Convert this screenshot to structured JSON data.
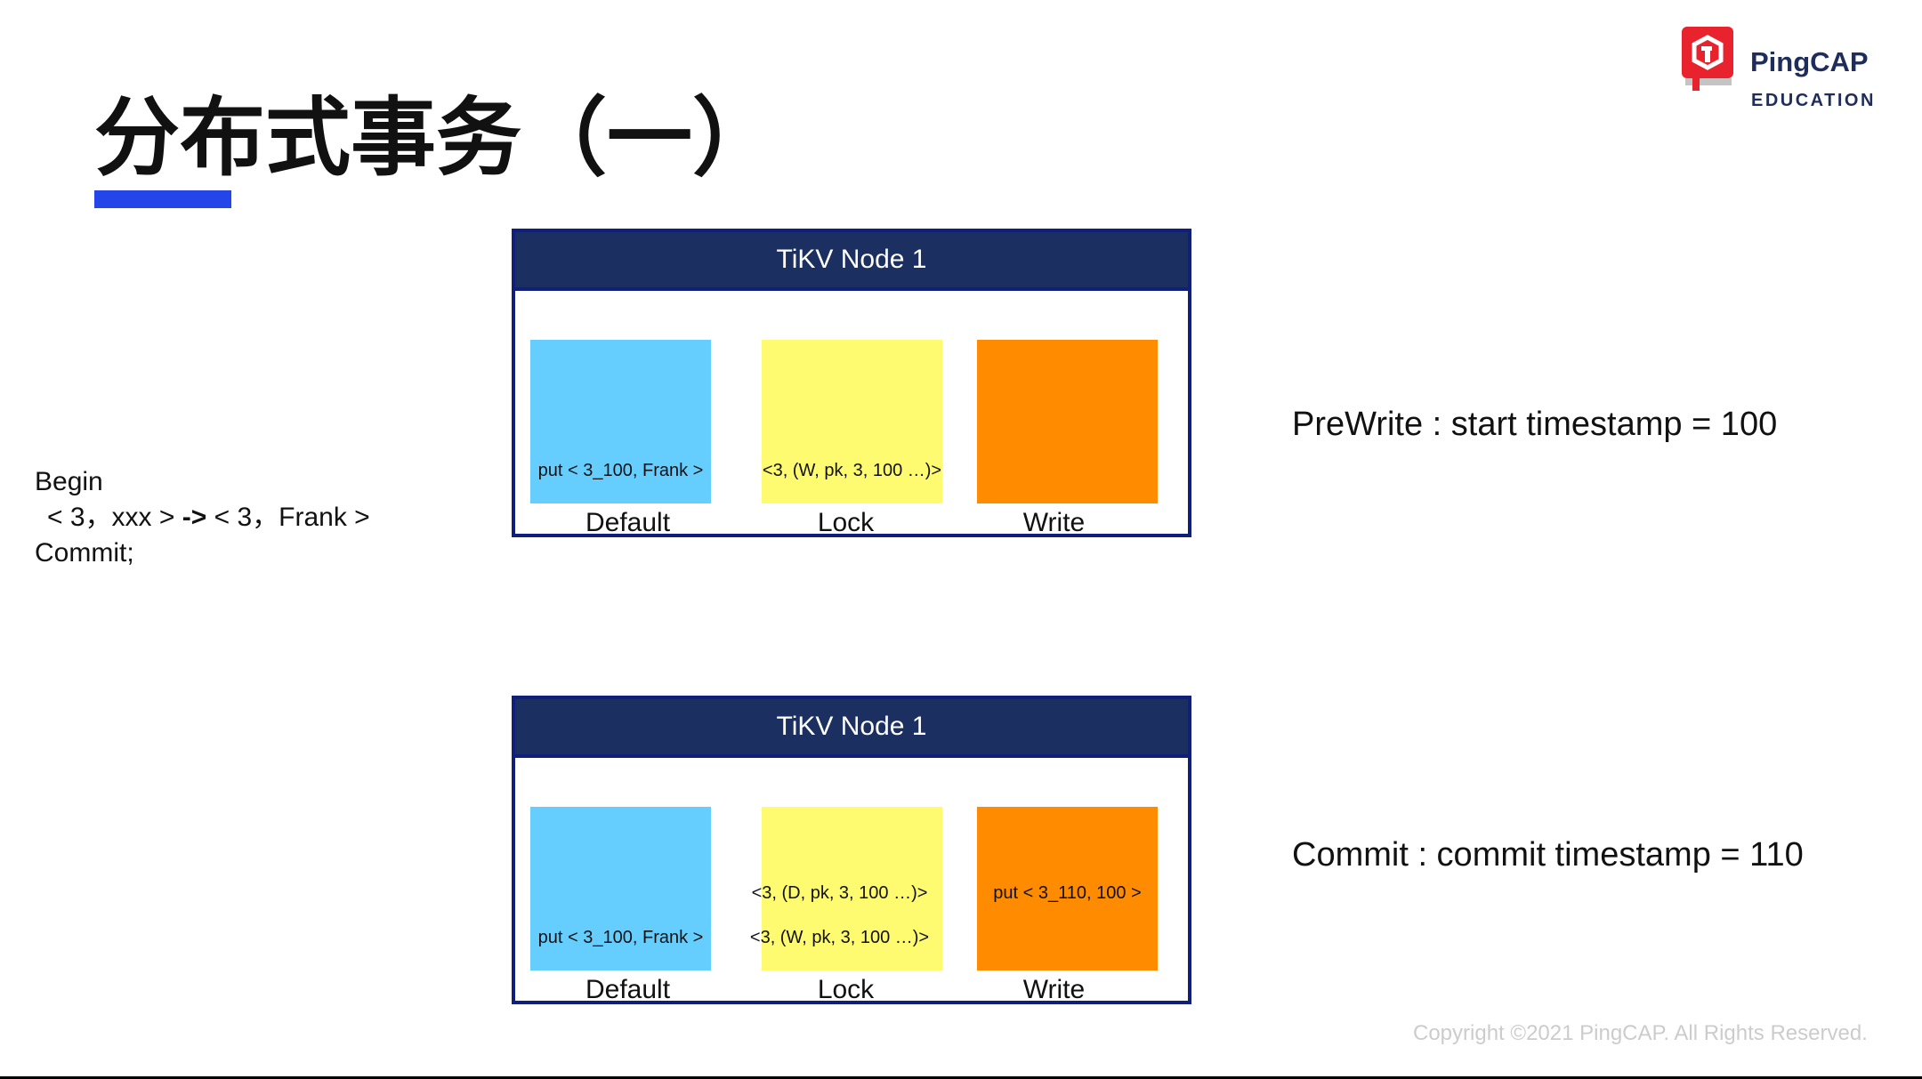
{
  "slide": {
    "title": "分布式事务（一）",
    "copyright": "Copyright ©2021 PingCAP. All Rights Reserved."
  },
  "logo": {
    "name": "PingCAP",
    "subtitle": "EDUCATION",
    "icon": "pingcap-logo-icon",
    "brand_color": "#e8232e"
  },
  "transaction": {
    "begin": "Begin",
    "open1": "< 3",
    "sep1": "，",
    "val1": "xxx >",
    "arrow": "->",
    "open2": "< 3",
    "sep2": "，",
    "val2": "Frank >",
    "commit": "Commit;"
  },
  "nodes": [
    {
      "title": "TiKV Node 1",
      "default_entries": [
        "put < 3_100, Frank >"
      ],
      "lock_entries": [
        "<3, (W, pk, 3, 100 …)>"
      ],
      "write_entries": [],
      "labels": [
        "Default",
        "Lock",
        "Write"
      ]
    },
    {
      "title": "TiKV Node 1",
      "default_entries": [
        "put < 3_100, Frank >"
      ],
      "lock_entries": [
        "<3, (D, pk, 3, 100 …)>",
        "<3, (W, pk, 3, 100 …)>"
      ],
      "write_entries": [
        "put < 3_110, 100 >"
      ],
      "labels": [
        "Default",
        "Lock",
        "Write"
      ]
    }
  ],
  "phases": [
    "PreWrite : start timestamp = 100",
    "Commit : commit timestamp = 110"
  ],
  "colors": {
    "accent_bar": "#2446e8",
    "node_header": "#1b3061",
    "node_border": "#0f1f7a",
    "default_cf": "#66ceff",
    "lock_cf": "#fefb70",
    "write_cf": "#ff8b00"
  }
}
